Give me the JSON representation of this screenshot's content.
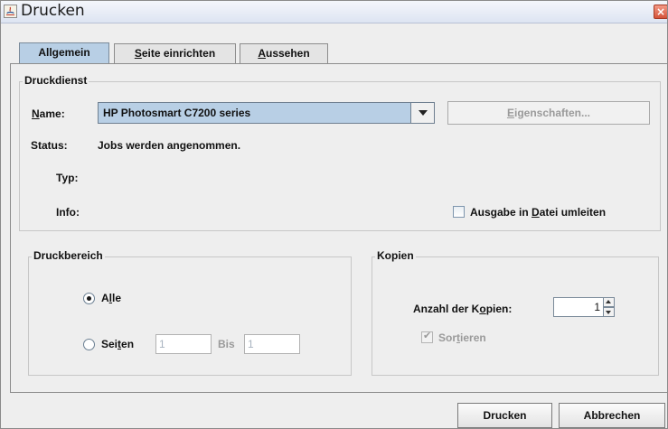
{
  "window": {
    "title": "Drucken",
    "close_icon": "×"
  },
  "tabs": [
    {
      "label_pre": "All",
      "label_mnemonic": "g",
      "label_post": "emein",
      "active": true
    },
    {
      "label_pre": "",
      "label_mnemonic": "S",
      "label_post": "eite einrichten",
      "active": false
    },
    {
      "label_pre": "",
      "label_mnemonic": "A",
      "label_post": "ussehen",
      "active": false
    }
  ],
  "druckdienst": {
    "title": "Druckdienst",
    "name_label_mnemonic": "N",
    "name_label_rest": "ame:",
    "printer": "HP Photosmart C7200 series",
    "properties_pre": "",
    "properties_mnemonic": "E",
    "properties_post": "igenschaften...",
    "status_label": "Status:",
    "status_value": "Jobs werden angenommen.",
    "typ_label": "Typ:",
    "info_label": "Info:",
    "file_pre": "Ausgabe in ",
    "file_mnemonic": "D",
    "file_post": "atei umleiten"
  },
  "druckbereich": {
    "title": "Druckbereich",
    "alle_pre": "A",
    "alle_mnemonic": "l",
    "alle_post": "le",
    "seiten_pre": "Sei",
    "seiten_mnemonic": "t",
    "seiten_post": "en",
    "from_value": "1",
    "bis_label": "Bis",
    "to_value": "1"
  },
  "kopien": {
    "title": "Kopien",
    "count_pre": "Anzahl der K",
    "count_mnemonic": "o",
    "count_post": "pien:",
    "count_value": "1",
    "sort_pre": "Sor",
    "sort_mnemonic": "t",
    "sort_post": "ieren"
  },
  "buttons": {
    "print": "Drucken",
    "cancel": "Abbrechen"
  }
}
